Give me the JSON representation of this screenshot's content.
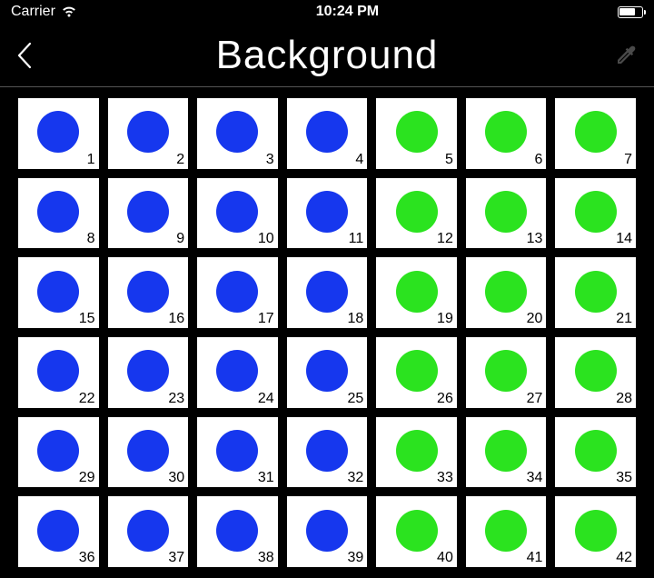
{
  "status": {
    "carrier": "Carrier",
    "time": "10:24 PM"
  },
  "nav": {
    "title": "Background"
  },
  "palette": {
    "blue": "#1637ee",
    "green": "#2be31f"
  },
  "cells": [
    {
      "idx": "1",
      "color": "blue"
    },
    {
      "idx": "2",
      "color": "blue"
    },
    {
      "idx": "3",
      "color": "blue"
    },
    {
      "idx": "4",
      "color": "blue"
    },
    {
      "idx": "5",
      "color": "green"
    },
    {
      "idx": "6",
      "color": "green"
    },
    {
      "idx": "7",
      "color": "green"
    },
    {
      "idx": "8",
      "color": "blue"
    },
    {
      "idx": "9",
      "color": "blue"
    },
    {
      "idx": "10",
      "color": "blue"
    },
    {
      "idx": "11",
      "color": "blue"
    },
    {
      "idx": "12",
      "color": "green"
    },
    {
      "idx": "13",
      "color": "green"
    },
    {
      "idx": "14",
      "color": "green"
    },
    {
      "idx": "15",
      "color": "blue"
    },
    {
      "idx": "16",
      "color": "blue"
    },
    {
      "idx": "17",
      "color": "blue"
    },
    {
      "idx": "18",
      "color": "blue"
    },
    {
      "idx": "19",
      "color": "green"
    },
    {
      "idx": "20",
      "color": "green"
    },
    {
      "idx": "21",
      "color": "green"
    },
    {
      "idx": "22",
      "color": "blue"
    },
    {
      "idx": "23",
      "color": "blue"
    },
    {
      "idx": "24",
      "color": "blue"
    },
    {
      "idx": "25",
      "color": "blue"
    },
    {
      "idx": "26",
      "color": "green"
    },
    {
      "idx": "27",
      "color": "green"
    },
    {
      "idx": "28",
      "color": "green"
    },
    {
      "idx": "29",
      "color": "blue"
    },
    {
      "idx": "30",
      "color": "blue"
    },
    {
      "idx": "31",
      "color": "blue"
    },
    {
      "idx": "32",
      "color": "blue"
    },
    {
      "idx": "33",
      "color": "green"
    },
    {
      "idx": "34",
      "color": "green"
    },
    {
      "idx": "35",
      "color": "green"
    },
    {
      "idx": "36",
      "color": "blue"
    },
    {
      "idx": "37",
      "color": "blue"
    },
    {
      "idx": "38",
      "color": "blue"
    },
    {
      "idx": "39",
      "color": "blue"
    },
    {
      "idx": "40",
      "color": "green"
    },
    {
      "idx": "41",
      "color": "green"
    },
    {
      "idx": "42",
      "color": "green"
    }
  ]
}
